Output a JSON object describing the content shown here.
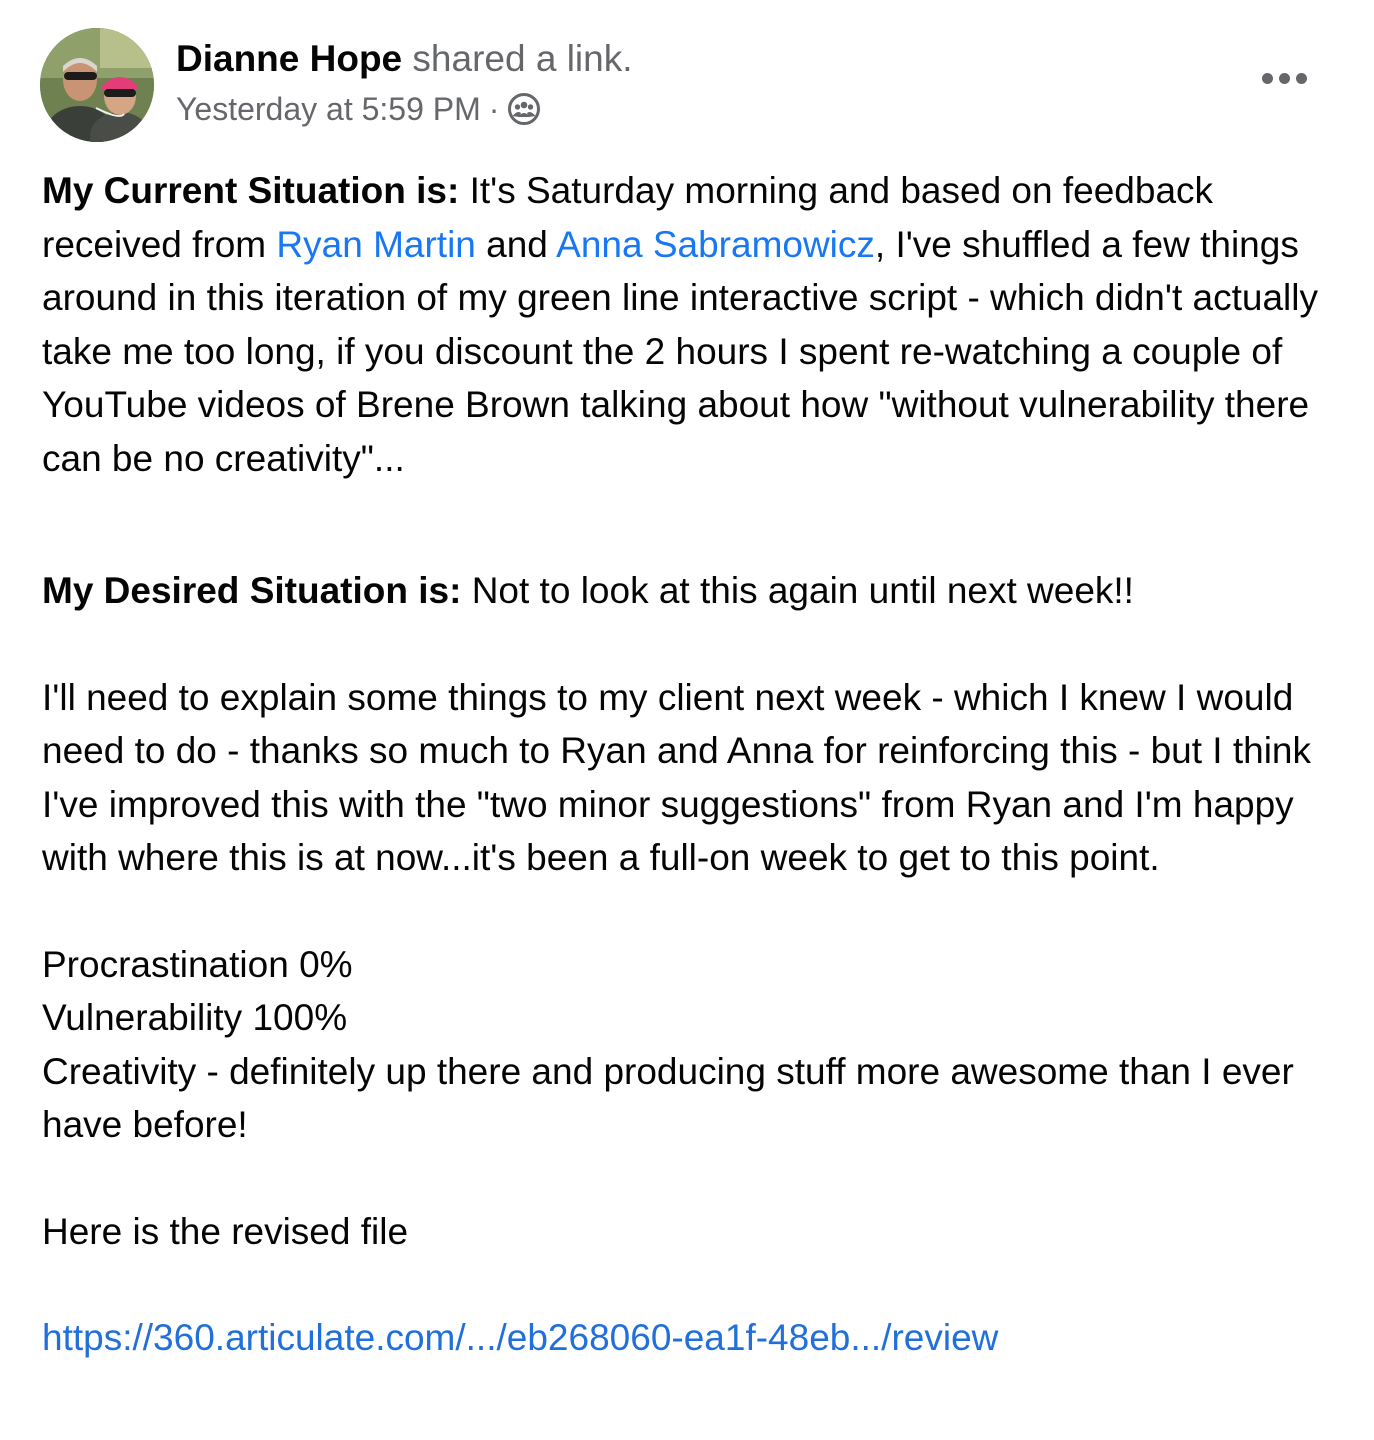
{
  "header": {
    "author_name": "Dianne Hope",
    "action_text": "shared a link.",
    "timestamp": "Yesterday at 5:59 PM",
    "separator": "·",
    "audience_icon": "group-icon",
    "more_icon": "more-options-icon"
  },
  "post": {
    "para1": {
      "label": "My Current Situation is:",
      "text_a": "It's Saturday morning and based on feedback received from",
      "mention1": "Ryan Martin",
      "text_b": "and",
      "mention2": "Anna Sabramowicz",
      "text_c": ", I've shuffled a few things around in this iteration of my green line interactive script - which didn't actually take me too long, if you discount the 2 hours I spent re-watching a couple of YouTube videos of Brene Brown talking about how \"without vulnerability there can be no creativity\"..."
    },
    "para2": {
      "label": "My Desired Situation is:",
      "text": "Not to look at this again until next week!!"
    },
    "para3": "I'll need to explain some things to my client next week - which I knew I would need to do - thanks so much to Ryan and Anna for reinforcing this - but I think I've improved this with the \"two minor suggestions\" from Ryan and I'm happy with where this is at now...it's been a full-on week to get to this point.",
    "stats": [
      "Procrastination 0%",
      "Vulnerability 100%",
      "Creativity - definitely up there and producing stuff more awesome than I ever have before!"
    ],
    "para5": "Here is the revised file",
    "link": "https://360.articulate.com/.../eb268060-ea1f-48eb.../review"
  },
  "colors": {
    "mention": "#1877f2",
    "secondary_text": "#65676b",
    "primary_text": "#050505"
  }
}
